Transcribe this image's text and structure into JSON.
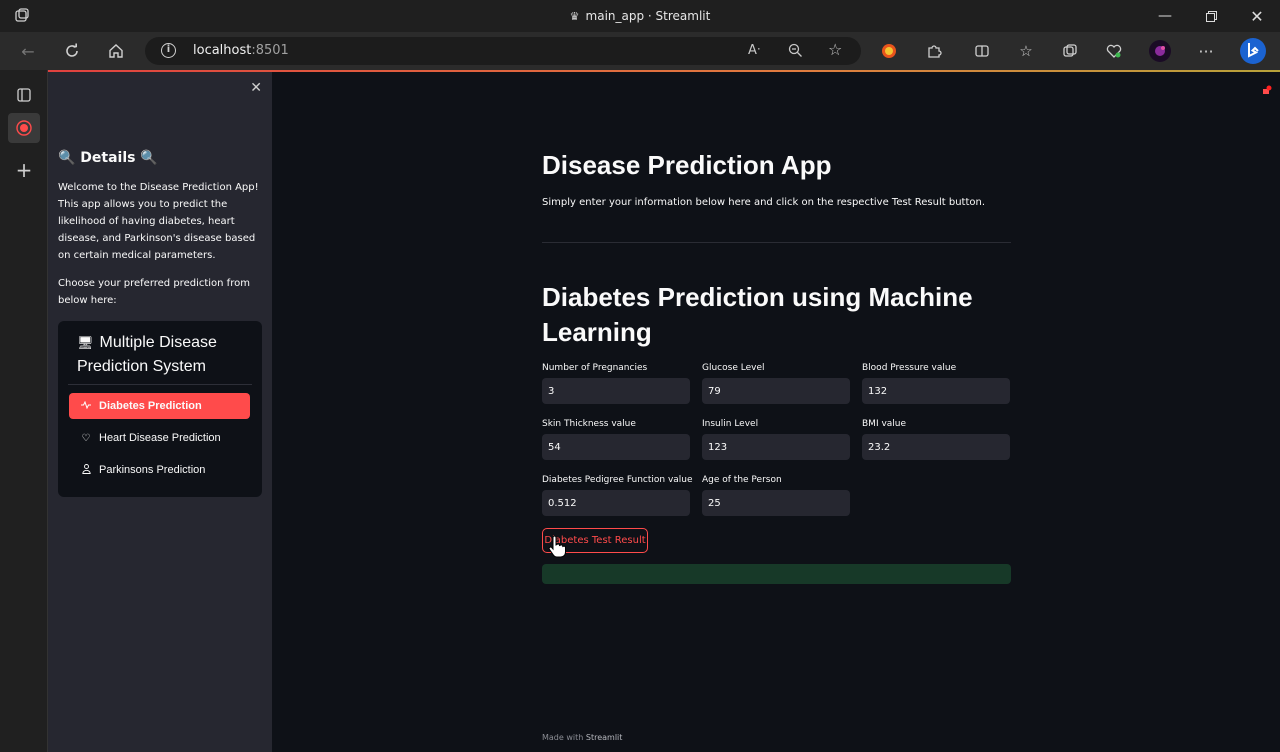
{
  "browser": {
    "window_title": "main_app · Streamlit",
    "url_host": "localhost",
    "url_port": ":8501"
  },
  "sidebar": {
    "heading": "🔍 Details 🔍",
    "intro": "Welcome to the Disease Prediction App! This app allows you to predict the likelihood of having diabetes, heart disease, and Parkinson's disease based on certain medical parameters.",
    "choose": "Choose your preferred prediction from below here:",
    "menu": {
      "title": "Multiple Disease Prediction System",
      "title_icon": "server-icon",
      "items": [
        {
          "label": "Diabetes Prediction",
          "icon": "activity-icon",
          "selected": true
        },
        {
          "label": "Heart Disease Prediction",
          "icon": "heart-icon",
          "selected": false
        },
        {
          "label": "Parkinsons Prediction",
          "icon": "person-icon",
          "selected": false
        }
      ]
    }
  },
  "main": {
    "title": "Disease Prediction App",
    "subtitle": "Simply enter your information below here and click on the respective Test Result button.",
    "section_title_line1": "Diabetes Prediction using Machine",
    "section_title_line2": "Learning",
    "fields": [
      {
        "label": "Number of Pregnancies",
        "value": "3"
      },
      {
        "label": "Glucose Level",
        "value": "79"
      },
      {
        "label": "Blood Pressure value",
        "value": "132"
      },
      {
        "label": "Skin Thickness value",
        "value": "54"
      },
      {
        "label": "Insulin Level",
        "value": "123"
      },
      {
        "label": "BMI value",
        "value": "23.2"
      },
      {
        "label": "Diabetes Pedigree Function value",
        "value": "0.512"
      },
      {
        "label": "Age of the Person",
        "value": "25"
      }
    ],
    "button_label": "Diabetes Test Result",
    "footer_prefix": "Made with",
    "footer_brand": "Streamlit"
  },
  "colors": {
    "accent": "#ff4b4b",
    "background": "#0e1117",
    "sidebar": "#262730",
    "success": "#173928"
  }
}
